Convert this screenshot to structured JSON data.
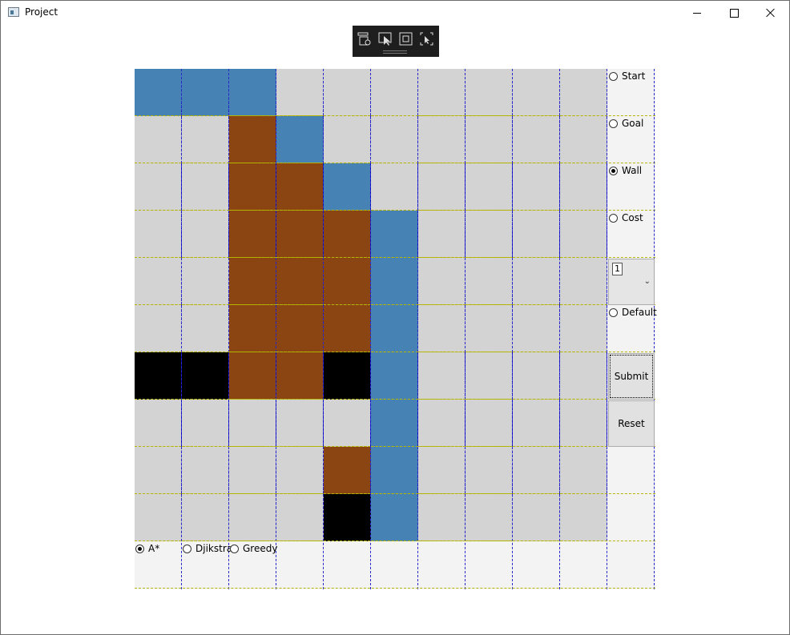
{
  "window": {
    "title": "Project"
  },
  "debug_toolbar": {
    "icons": [
      "live-visual-tree-icon",
      "select-element-icon",
      "display-layout-adorners-icon",
      "track-focused-element-icon"
    ]
  },
  "grid": {
    "rows": [
      [
        "path",
        "path",
        "path",
        "empty",
        "empty",
        "empty",
        "empty",
        "empty",
        "empty",
        "empty"
      ],
      [
        "empty",
        "empty",
        "cost",
        "path",
        "empty",
        "empty",
        "empty",
        "empty",
        "empty",
        "empty"
      ],
      [
        "empty",
        "empty",
        "cost",
        "cost",
        "path",
        "empty",
        "empty",
        "empty",
        "empty",
        "empty"
      ],
      [
        "empty",
        "empty",
        "cost",
        "cost",
        "cost",
        "path",
        "empty",
        "empty",
        "empty",
        "empty"
      ],
      [
        "empty",
        "empty",
        "cost",
        "cost",
        "cost",
        "path",
        "empty",
        "empty",
        "empty",
        "empty"
      ],
      [
        "empty",
        "empty",
        "cost",
        "cost",
        "cost",
        "path",
        "empty",
        "empty",
        "empty",
        "empty"
      ],
      [
        "wall",
        "wall",
        "cost",
        "cost",
        "wall",
        "path",
        "empty",
        "empty",
        "empty",
        "empty"
      ],
      [
        "empty",
        "empty",
        "empty",
        "empty",
        "empty",
        "path",
        "empty",
        "empty",
        "empty",
        "empty"
      ],
      [
        "empty",
        "empty",
        "empty",
        "empty",
        "cost",
        "path",
        "empty",
        "empty",
        "empty",
        "empty"
      ],
      [
        "empty",
        "empty",
        "empty",
        "empty",
        "wall",
        "path",
        "empty",
        "empty",
        "empty",
        "empty"
      ]
    ],
    "colors": {
      "empty": "#d3d3d3",
      "path": "#4682b4",
      "cost": "#8b4513",
      "wall": "#000000"
    }
  },
  "side_panel": {
    "start_label": "Start",
    "goal_label": "Goal",
    "wall_label": "Wall",
    "cost_label": "Cost",
    "cost_value": "1",
    "default_label": "Default",
    "selected_mode": "Wall",
    "submit_label": "Submit",
    "reset_label": "Reset"
  },
  "algorithms": {
    "astar_label": "A*",
    "dijkstra_label": "Djikstra",
    "greedy_label": "Greedy",
    "selected": "A*"
  }
}
